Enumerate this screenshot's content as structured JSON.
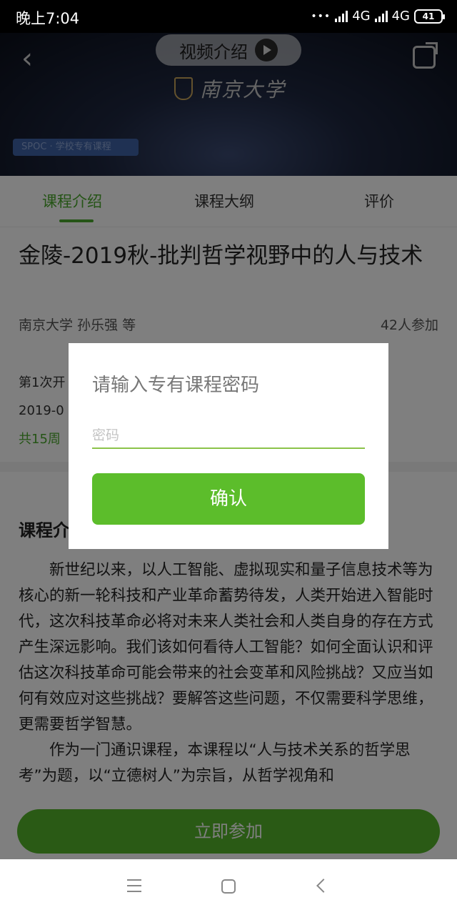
{
  "status_bar": {
    "time": "晚上7:04",
    "network_1": "4G",
    "network_2": "4G",
    "battery": "41"
  },
  "header": {
    "video_intro_label": "视频介绍",
    "university_logo_text": "南京大学",
    "tag": "SPOC · 学校专有课程"
  },
  "tabs": [
    {
      "label": "课程介绍",
      "active": true
    },
    {
      "label": "课程大纲",
      "active": false
    },
    {
      "label": "评价",
      "active": false
    }
  ],
  "course": {
    "title": "金陵-2019秋-批判哲学视野中的人与技术",
    "teachers": "南京大学 孙乐强 等",
    "participants": "42人参加",
    "session_partial": "第1次开",
    "date_partial": "2019-0",
    "weeks_partial": "共15周"
  },
  "intro": {
    "heading_partial": "课程介",
    "paragraph_1": "新世纪以来，以人工智能、虚拟现实和量子信息技术等为核心的新一轮科技和产业革命蓄势待发，人类开始进入智能时代，这次科技革命必将对未来人类社会和人类自身的存在方式产生深远影响。我们该如何看待人工智能？如何全面认识和评估这次科技革命可能会带来的社会变革和风险挑战？又应当如何有效应对这些挑战？要解答这些问题，不仅需要科学思维，更需要哲学智慧。",
    "paragraph_2": "作为一门通识课程，本课程以“人与技术关系的哲学思考”为题，以“立德树人”为宗旨，从哲学视角和"
  },
  "join_button_label": "立即参加",
  "dialog": {
    "title": "请输入专有课程密码",
    "password_placeholder": "密码",
    "password_value": "",
    "confirm_label": "确认"
  },
  "colors": {
    "accent": "#4aa82c",
    "confirm_button": "#5cbd2b",
    "input_underline": "#8bc34a"
  },
  "icons": [
    "back-icon",
    "play-icon",
    "share-icon",
    "menu-icon",
    "home-icon",
    "nav-back-icon"
  ]
}
